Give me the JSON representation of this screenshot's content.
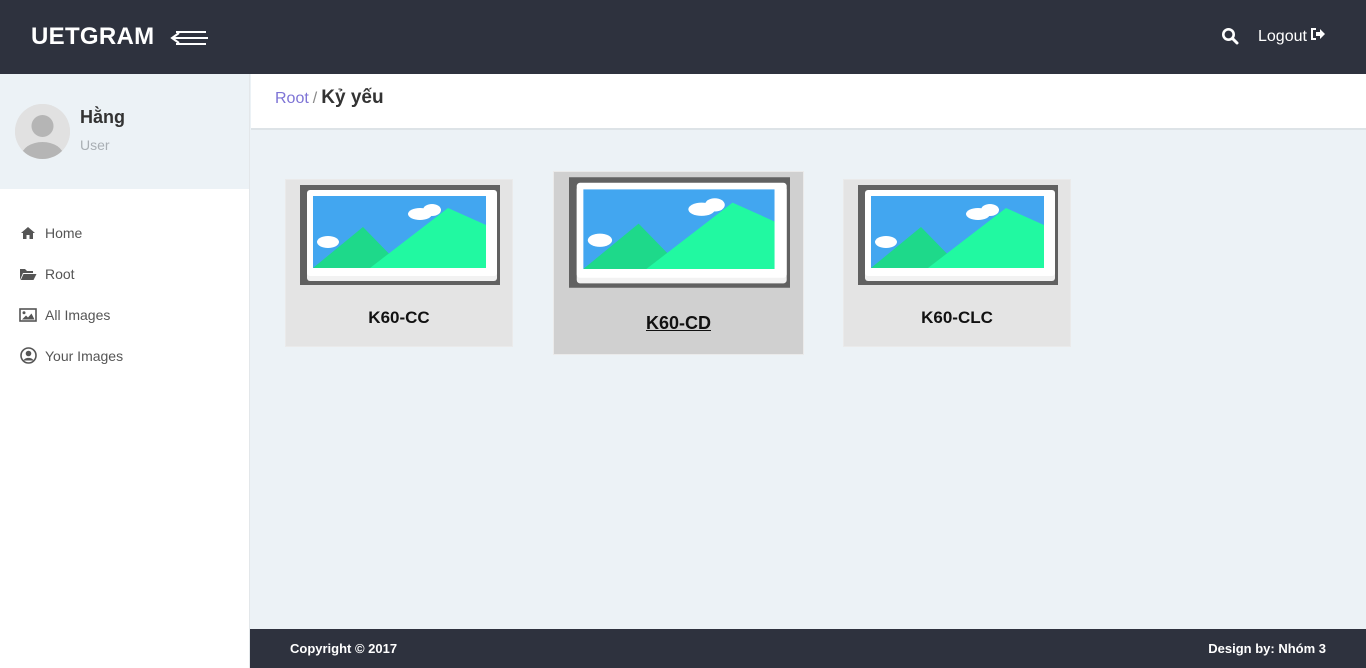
{
  "header": {
    "brand": "UETGRAM",
    "logout_label": "Logout"
  },
  "user": {
    "name": "Hằng",
    "role": "User"
  },
  "sidebar": {
    "items": [
      {
        "label": "Home",
        "icon": "home-icon"
      },
      {
        "label": "Root",
        "icon": "folder-open-icon"
      },
      {
        "label": "All Images",
        "icon": "image-icon"
      },
      {
        "label": "Your Images",
        "icon": "user-circle-icon"
      }
    ]
  },
  "breadcrumb": {
    "root": "Root",
    "separator": "/",
    "current": "Kỷ yếu"
  },
  "albums": [
    {
      "label": "K60-CC"
    },
    {
      "label": "K60-CD",
      "state": "hover"
    },
    {
      "label": "K60-CLC"
    }
  ],
  "footer": {
    "copyright": "Copyright © 2017",
    "design": "Design by: Nhóm 3"
  },
  "colors": {
    "topbar": "#2e323e",
    "content_bg": "#ecf2f6",
    "link": "#7e74d6",
    "card_bg": "#e4e4e4",
    "card_active_bg": "#d0d0d0"
  }
}
